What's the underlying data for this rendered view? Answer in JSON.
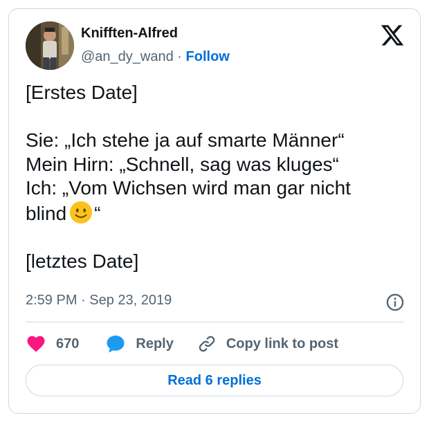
{
  "author": {
    "name": "Knifften-Alfred",
    "handle": "@an_dy_wand",
    "separator": "·",
    "follow_label": "Follow"
  },
  "tweet": {
    "lines": [
      "[Erstes Date]",
      "",
      "Sie: „Ich stehe ja auf smarte Männer“",
      "Mein Hirn: „Schnell, sag was kluges“",
      "Ich: „Vom Wichsen wird man gar nicht",
      "blind",
      "",
      "[letztes Date]"
    ],
    "emoji": "slightly-smiling-face",
    "after_emoji": "“"
  },
  "timestamp": {
    "time": "2:59 PM",
    "separator": "·",
    "date": "Sep 23, 2019"
  },
  "actions": {
    "likes_count": "670",
    "reply_label": "Reply",
    "copy_label": "Copy link to post"
  },
  "read_replies_label": "Read 6 replies",
  "colors": {
    "like": "#f91880",
    "reply": "#1d9bf0",
    "link": "#006fd6",
    "muted": "#536471",
    "border": "#cfd9de"
  },
  "icons": [
    "x-logo-icon",
    "info-icon",
    "heart-icon",
    "reply-bubble-icon",
    "link-icon"
  ]
}
